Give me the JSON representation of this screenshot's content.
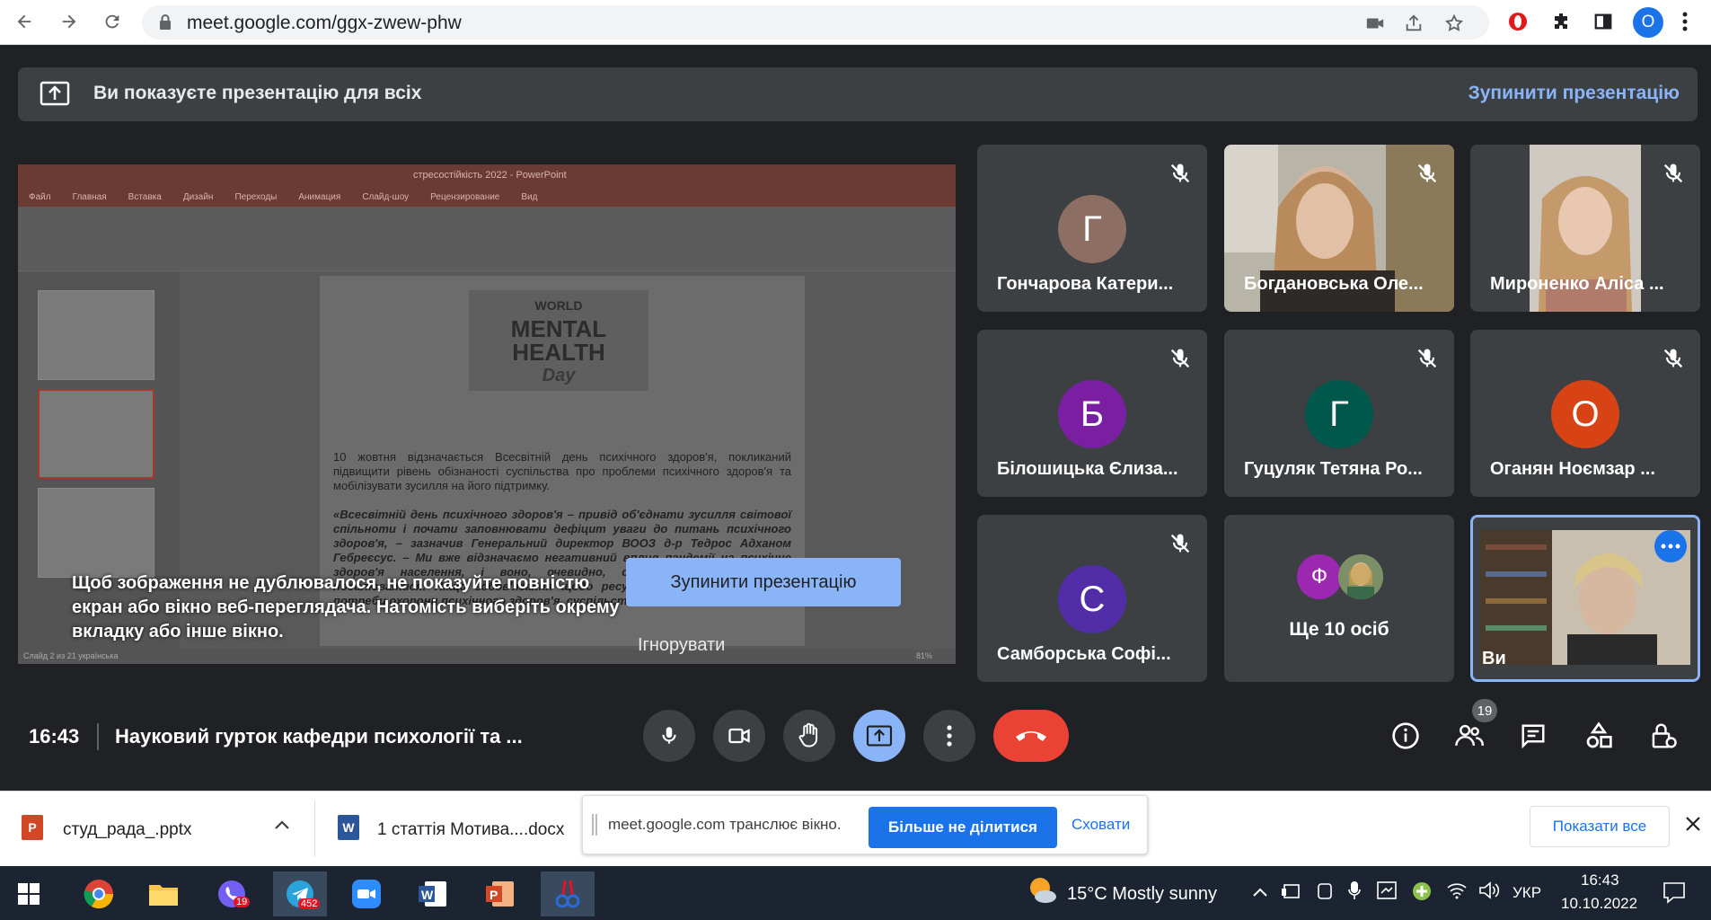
{
  "browser": {
    "url": "meet.google.com/ggx-zwew-phw",
    "profile_initial": "O"
  },
  "presenting_bar": {
    "text": "Ви показуєте презентацію для всіх",
    "stop_label": "Зупинити презентацію"
  },
  "presentation": {
    "window_title": "стресостійкість 2022 - PowerPoint",
    "tabs": [
      "Файл",
      "Главная",
      "Вставка",
      "Дизайн",
      "Переходы",
      "Анимация",
      "Слайд-шоу",
      "Рецензирование",
      "Вид"
    ],
    "slide_logo": [
      "WORLD",
      "MENTAL",
      "HEALTH",
      "Day"
    ],
    "slide_text": "10 жовтня відзначається Всесвітній день психічного здоров'я, покликаний підвищити рівень обізнаності суспільства про проблеми психічного здоров'я та мобілізувати зусилля на його підтримку.",
    "slide_quote": "«Всесвітній день психічного здоров'я – привід об'єднати зусилля світової спільноти і почати заповнювати дефіцит уваги до питань психічного здоров'я, – зазначив Генеральний директор ВООЗ д-р Тедрос Адханом Гебреєсус. – Ми вже відзначаємо негативний вплив пандемії на психічне здоров'я населення, і воно, очевидно, очікується, буде тільки посилюватися. Якщо зобов'язання щодо ресурсів, що виділяються на потреби охорони психічного здоров'я, суспільства і економіки».",
    "status_left": "Слайд 2 из 21   українська",
    "zoom": "81%"
  },
  "duplicate_warning": {
    "message": "Щоб зображення не дублювалося, не показуйте повністю екран або вікно веб-переглядача. Натомість виберіть окрему вкладку або інше вікно.",
    "stop_label": "Зупинити презентацію",
    "ignore_label": "Ігнорувати"
  },
  "participants": [
    {
      "name": "Гончарова Катери...",
      "initial": "Г",
      "color": "#8d6e63",
      "video": false
    },
    {
      "name": "Богдановська Оле...",
      "initial": "",
      "color": "#6d5a4c",
      "video": true
    },
    {
      "name": "Мироненко Аліса ...",
      "initial": "",
      "color": "#8a6a5a",
      "video": true
    },
    {
      "name": "Білошицька Єлиза...",
      "initial": "Б",
      "color": "#7b1fa2",
      "video": false
    },
    {
      "name": "Гуцуляк Тетяна Ро...",
      "initial": "Г",
      "color": "#00574b",
      "video": false
    },
    {
      "name": "Оганян Ноємзар ...",
      "initial": "О",
      "color": "#d84315",
      "video": false
    },
    {
      "name": "Самборська Софі...",
      "initial": "С",
      "color": "#512da8",
      "video": false
    }
  ],
  "more_tile": {
    "label": "Ще 10 осіб",
    "initial": "Ф",
    "color": "#9c27b0"
  },
  "self_tile": {
    "label": "Ви"
  },
  "controls": {
    "time": "16:43",
    "meeting_title": "Науковий гурток кафедри психології та ...",
    "participants_count": "19"
  },
  "downloads": {
    "file1": "студ_рада_.pptx",
    "file2": "1 статтія Мотива....docx",
    "share_text": "meet.google.com транслює вікно.",
    "share_stop": "Більше не ділитися",
    "share_hide": "Сховати",
    "show_all": "Показати все"
  },
  "taskbar": {
    "telegram_badge": "452",
    "viber_badge": "19",
    "weather": "15°C  Mostly sunny",
    "lang": "УКР",
    "time": "16:43",
    "date": "10.10.2022"
  },
  "colors": {
    "meet_bg": "#202124",
    "accent_blue": "#8ab4f8",
    "end_call_red": "#ea4335"
  }
}
